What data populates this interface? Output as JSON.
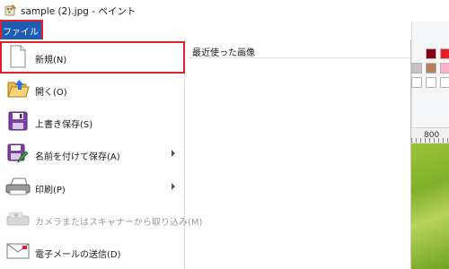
{
  "window": {
    "title": "sample (2).jpg - ペイント",
    "app_icon": "paint-app-icon"
  },
  "file_tab": {
    "label": "ファイル",
    "color": "#1f5cb4",
    "highlight_color": "#e0202a"
  },
  "file_menu": {
    "items": [
      {
        "label": "新規(N)",
        "icon": "new-document-icon",
        "has_submenu": false,
        "enabled": true,
        "highlighted": true
      },
      {
        "label": "開く(O)",
        "icon": "open-folder-icon",
        "has_submenu": false,
        "enabled": true
      },
      {
        "label": "上書き保存(S)",
        "icon": "save-icon",
        "has_submenu": false,
        "enabled": true
      },
      {
        "label": "名前を付けて保存(A)",
        "icon": "save-as-icon",
        "has_submenu": true,
        "enabled": true
      },
      {
        "label": "印刷(P)",
        "icon": "printer-icon",
        "has_submenu": true,
        "enabled": true
      },
      {
        "label": "カメラまたはスキャナーから取り込み(M)",
        "icon": "scanner-icon",
        "has_submenu": false,
        "enabled": false
      },
      {
        "label": "電子メールの送信(D)",
        "icon": "email-icon",
        "has_submenu": false,
        "enabled": true
      }
    ],
    "recent_title": "最近使った画像"
  },
  "ruler": {
    "label": "800"
  },
  "palette": {
    "colors": [
      "#880015",
      "#ed1c24",
      "#c3c3c3",
      "#b97a57",
      "#ffaec9",
      "#ffffff",
      "#ffffff",
      "#ffffff"
    ]
  }
}
